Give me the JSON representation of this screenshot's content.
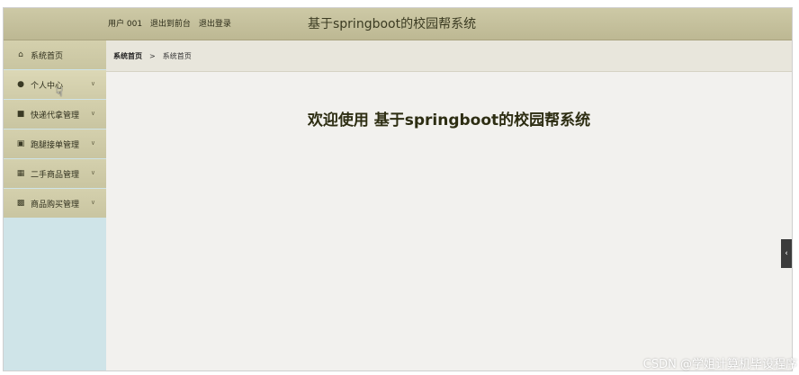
{
  "header": {
    "user_label": "用户 001",
    "front_link": "退出到前台",
    "logout_link": "退出登录",
    "title": "基于springboot的校园帮系统"
  },
  "sidebar": {
    "items": [
      {
        "label": "系统首页",
        "icon": "home-icon"
      },
      {
        "label": "个人中心",
        "icon": "user-icon"
      },
      {
        "label": "快递代拿管理",
        "icon": "message-icon"
      },
      {
        "label": "跑腿接单管理",
        "icon": "briefcase-icon"
      },
      {
        "label": "二手商品管理",
        "icon": "grid-icon"
      },
      {
        "label": "商品购买管理",
        "icon": "clipboard-icon"
      }
    ]
  },
  "breadcrumb": {
    "root": "系统首页",
    "separator": ">",
    "current": "系统首页"
  },
  "main": {
    "welcome": "欢迎使用 基于springboot的校园帮系统"
  },
  "watermark": "CSDN @学姐计算机毕设程序"
}
